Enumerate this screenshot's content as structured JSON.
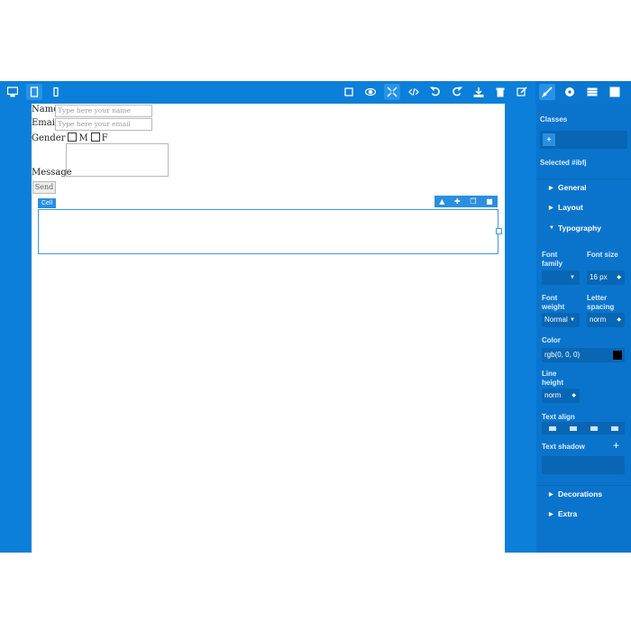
{
  "toolbar": {
    "device_icons": [
      "desktop-icon",
      "tablet-icon",
      "mobile-icon"
    ],
    "action_icons": [
      "square-icon",
      "eye-icon",
      "fullscreen-icon",
      "code-icon",
      "undo-icon",
      "redo-icon",
      "download-icon",
      "trash-icon",
      "edit-icon"
    ],
    "panel_tabs": [
      "brush-icon",
      "gear-icon",
      "layers-icon",
      "blocks-icon"
    ]
  },
  "form": {
    "name_label": "Name",
    "name_placeholder": "Type here your name",
    "email_label": "Email",
    "email_placeholder": "Type here your email",
    "gender_label": "Gender",
    "gender_m": "M",
    "gender_f": "F",
    "message_label": "Message",
    "send_label": "Send"
  },
  "cell": {
    "tag": "Cell"
  },
  "panel": {
    "classes_label": "Classes",
    "add_class": "+",
    "selected_label": "Selected #ibfj",
    "sections": {
      "general": "General",
      "layout": "Layout",
      "typography": "Typography",
      "decorations": "Decorations",
      "extra": "Extra"
    },
    "font_family_label": "Font family",
    "font_size_label": "Font size",
    "font_size_value": "16 px",
    "font_weight_label": "Font weight",
    "font_weight_value": "Normal",
    "letter_spacing_label": "Letter spacing",
    "letter_spacing_value": "norm",
    "color_label": "Color",
    "color_value": "rgb(0, 0, 0)",
    "line_height_label": "Line height",
    "line_height_value": "norm",
    "text_align_label": "Text align",
    "text_shadow_label": "Text shadow",
    "text_shadow_add": "+"
  },
  "colors": {
    "accent": "#0b7fd9",
    "panel": "#0a74cc",
    "field": "#0866b4",
    "selection": "#3d98e4"
  }
}
